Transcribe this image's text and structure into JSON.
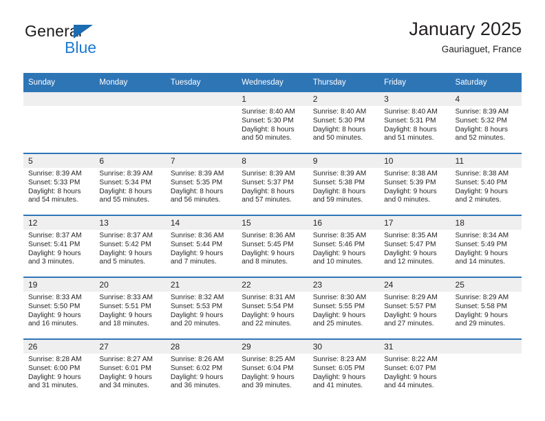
{
  "brand": {
    "name_part1": "General",
    "name_part2": "Blue",
    "triangle_icon": "blue-triangle-logo-icon"
  },
  "header": {
    "title": "January 2025",
    "subtitle": "Gauriaguet, France"
  },
  "colors": {
    "header_blue": "#2e75b6",
    "row_divider_blue": "#2e75b6",
    "daynum_band_gray": "#efefef",
    "logo_blue": "#1b7ad1",
    "text": "#231f20"
  },
  "calendar": {
    "weekday_headers": [
      "Sunday",
      "Monday",
      "Tuesday",
      "Wednesday",
      "Thursday",
      "Friday",
      "Saturday"
    ],
    "weeks": [
      [
        {
          "day": "",
          "sunrise": "",
          "sunset": "",
          "daylight_line1": "",
          "daylight_line2": "",
          "empty": true
        },
        {
          "day": "",
          "sunrise": "",
          "sunset": "",
          "daylight_line1": "",
          "daylight_line2": "",
          "empty": true
        },
        {
          "day": "",
          "sunrise": "",
          "sunset": "",
          "daylight_line1": "",
          "daylight_line2": "",
          "empty": true
        },
        {
          "day": "1",
          "sunrise": "Sunrise: 8:40 AM",
          "sunset": "Sunset: 5:30 PM",
          "daylight_line1": "Daylight: 8 hours",
          "daylight_line2": "and 50 minutes.",
          "empty": false
        },
        {
          "day": "2",
          "sunrise": "Sunrise: 8:40 AM",
          "sunset": "Sunset: 5:30 PM",
          "daylight_line1": "Daylight: 8 hours",
          "daylight_line2": "and 50 minutes.",
          "empty": false
        },
        {
          "day": "3",
          "sunrise": "Sunrise: 8:40 AM",
          "sunset": "Sunset: 5:31 PM",
          "daylight_line1": "Daylight: 8 hours",
          "daylight_line2": "and 51 minutes.",
          "empty": false
        },
        {
          "day": "4",
          "sunrise": "Sunrise: 8:39 AM",
          "sunset": "Sunset: 5:32 PM",
          "daylight_line1": "Daylight: 8 hours",
          "daylight_line2": "and 52 minutes.",
          "empty": false
        }
      ],
      [
        {
          "day": "5",
          "sunrise": "Sunrise: 8:39 AM",
          "sunset": "Sunset: 5:33 PM",
          "daylight_line1": "Daylight: 8 hours",
          "daylight_line2": "and 54 minutes.",
          "empty": false
        },
        {
          "day": "6",
          "sunrise": "Sunrise: 8:39 AM",
          "sunset": "Sunset: 5:34 PM",
          "daylight_line1": "Daylight: 8 hours",
          "daylight_line2": "and 55 minutes.",
          "empty": false
        },
        {
          "day": "7",
          "sunrise": "Sunrise: 8:39 AM",
          "sunset": "Sunset: 5:35 PM",
          "daylight_line1": "Daylight: 8 hours",
          "daylight_line2": "and 56 minutes.",
          "empty": false
        },
        {
          "day": "8",
          "sunrise": "Sunrise: 8:39 AM",
          "sunset": "Sunset: 5:37 PM",
          "daylight_line1": "Daylight: 8 hours",
          "daylight_line2": "and 57 minutes.",
          "empty": false
        },
        {
          "day": "9",
          "sunrise": "Sunrise: 8:39 AM",
          "sunset": "Sunset: 5:38 PM",
          "daylight_line1": "Daylight: 8 hours",
          "daylight_line2": "and 59 minutes.",
          "empty": false
        },
        {
          "day": "10",
          "sunrise": "Sunrise: 8:38 AM",
          "sunset": "Sunset: 5:39 PM",
          "daylight_line1": "Daylight: 9 hours",
          "daylight_line2": "and 0 minutes.",
          "empty": false
        },
        {
          "day": "11",
          "sunrise": "Sunrise: 8:38 AM",
          "sunset": "Sunset: 5:40 PM",
          "daylight_line1": "Daylight: 9 hours",
          "daylight_line2": "and 2 minutes.",
          "empty": false
        }
      ],
      [
        {
          "day": "12",
          "sunrise": "Sunrise: 8:37 AM",
          "sunset": "Sunset: 5:41 PM",
          "daylight_line1": "Daylight: 9 hours",
          "daylight_line2": "and 3 minutes.",
          "empty": false
        },
        {
          "day": "13",
          "sunrise": "Sunrise: 8:37 AM",
          "sunset": "Sunset: 5:42 PM",
          "daylight_line1": "Daylight: 9 hours",
          "daylight_line2": "and 5 minutes.",
          "empty": false
        },
        {
          "day": "14",
          "sunrise": "Sunrise: 8:36 AM",
          "sunset": "Sunset: 5:44 PM",
          "daylight_line1": "Daylight: 9 hours",
          "daylight_line2": "and 7 minutes.",
          "empty": false
        },
        {
          "day": "15",
          "sunrise": "Sunrise: 8:36 AM",
          "sunset": "Sunset: 5:45 PM",
          "daylight_line1": "Daylight: 9 hours",
          "daylight_line2": "and 8 minutes.",
          "empty": false
        },
        {
          "day": "16",
          "sunrise": "Sunrise: 8:35 AM",
          "sunset": "Sunset: 5:46 PM",
          "daylight_line1": "Daylight: 9 hours",
          "daylight_line2": "and 10 minutes.",
          "empty": false
        },
        {
          "day": "17",
          "sunrise": "Sunrise: 8:35 AM",
          "sunset": "Sunset: 5:47 PM",
          "daylight_line1": "Daylight: 9 hours",
          "daylight_line2": "and 12 minutes.",
          "empty": false
        },
        {
          "day": "18",
          "sunrise": "Sunrise: 8:34 AM",
          "sunset": "Sunset: 5:49 PM",
          "daylight_line1": "Daylight: 9 hours",
          "daylight_line2": "and 14 minutes.",
          "empty": false
        }
      ],
      [
        {
          "day": "19",
          "sunrise": "Sunrise: 8:33 AM",
          "sunset": "Sunset: 5:50 PM",
          "daylight_line1": "Daylight: 9 hours",
          "daylight_line2": "and 16 minutes.",
          "empty": false
        },
        {
          "day": "20",
          "sunrise": "Sunrise: 8:33 AM",
          "sunset": "Sunset: 5:51 PM",
          "daylight_line1": "Daylight: 9 hours",
          "daylight_line2": "and 18 minutes.",
          "empty": false
        },
        {
          "day": "21",
          "sunrise": "Sunrise: 8:32 AM",
          "sunset": "Sunset: 5:53 PM",
          "daylight_line1": "Daylight: 9 hours",
          "daylight_line2": "and 20 minutes.",
          "empty": false
        },
        {
          "day": "22",
          "sunrise": "Sunrise: 8:31 AM",
          "sunset": "Sunset: 5:54 PM",
          "daylight_line1": "Daylight: 9 hours",
          "daylight_line2": "and 22 minutes.",
          "empty": false
        },
        {
          "day": "23",
          "sunrise": "Sunrise: 8:30 AM",
          "sunset": "Sunset: 5:55 PM",
          "daylight_line1": "Daylight: 9 hours",
          "daylight_line2": "and 25 minutes.",
          "empty": false
        },
        {
          "day": "24",
          "sunrise": "Sunrise: 8:29 AM",
          "sunset": "Sunset: 5:57 PM",
          "daylight_line1": "Daylight: 9 hours",
          "daylight_line2": "and 27 minutes.",
          "empty": false
        },
        {
          "day": "25",
          "sunrise": "Sunrise: 8:29 AM",
          "sunset": "Sunset: 5:58 PM",
          "daylight_line1": "Daylight: 9 hours",
          "daylight_line2": "and 29 minutes.",
          "empty": false
        }
      ],
      [
        {
          "day": "26",
          "sunrise": "Sunrise: 8:28 AM",
          "sunset": "Sunset: 6:00 PM",
          "daylight_line1": "Daylight: 9 hours",
          "daylight_line2": "and 31 minutes.",
          "empty": false
        },
        {
          "day": "27",
          "sunrise": "Sunrise: 8:27 AM",
          "sunset": "Sunset: 6:01 PM",
          "daylight_line1": "Daylight: 9 hours",
          "daylight_line2": "and 34 minutes.",
          "empty": false
        },
        {
          "day": "28",
          "sunrise": "Sunrise: 8:26 AM",
          "sunset": "Sunset: 6:02 PM",
          "daylight_line1": "Daylight: 9 hours",
          "daylight_line2": "and 36 minutes.",
          "empty": false
        },
        {
          "day": "29",
          "sunrise": "Sunrise: 8:25 AM",
          "sunset": "Sunset: 6:04 PM",
          "daylight_line1": "Daylight: 9 hours",
          "daylight_line2": "and 39 minutes.",
          "empty": false
        },
        {
          "day": "30",
          "sunrise": "Sunrise: 8:23 AM",
          "sunset": "Sunset: 6:05 PM",
          "daylight_line1": "Daylight: 9 hours",
          "daylight_line2": "and 41 minutes.",
          "empty": false
        },
        {
          "day": "31",
          "sunrise": "Sunrise: 8:22 AM",
          "sunset": "Sunset: 6:07 PM",
          "daylight_line1": "Daylight: 9 hours",
          "daylight_line2": "and 44 minutes.",
          "empty": false
        },
        {
          "day": "",
          "sunrise": "",
          "sunset": "",
          "daylight_line1": "",
          "daylight_line2": "",
          "empty": true
        }
      ]
    ]
  }
}
